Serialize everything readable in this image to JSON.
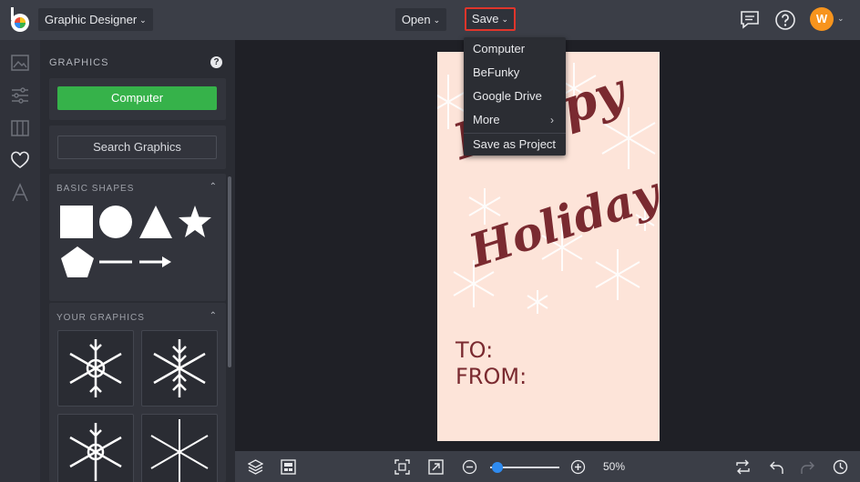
{
  "topbar": {
    "app_name": "Graphic Designer",
    "open_label": "Open",
    "save_label": "Save",
    "avatar_initial": "W"
  },
  "save_menu": {
    "items": [
      "Computer",
      "BeFunky",
      "Google Drive",
      "More",
      "Save as Project"
    ]
  },
  "panel": {
    "title": "GRAPHICS",
    "computer_button": "Computer",
    "search_button": "Search Graphics",
    "basic_shapes_label": "BASIC SHAPES",
    "your_graphics_label": "YOUR GRAPHICS"
  },
  "card": {
    "line1": "Happy",
    "line2": "Holidays",
    "to_label": "TO:",
    "from_label": "FROM:"
  },
  "bottombar": {
    "zoom_value": "50%"
  },
  "colors": {
    "accent_save_border": "#e0352b",
    "green_button": "#36b24a",
    "avatar": "#f7941d",
    "card_background": "#fde4d9",
    "card_text": "#7a2a30",
    "zoom_knob": "#2f8bf0"
  },
  "icons": [
    "befunky-logo",
    "comment-icon",
    "help-icon",
    "image-icon",
    "sliders-icon",
    "columns-icon",
    "heart-icon",
    "text-icon",
    "layers-icon",
    "layout-icon",
    "fit-icon",
    "fullscreen-icon",
    "zoom-out-icon",
    "zoom-in-icon",
    "replace-icon",
    "undo-icon",
    "redo-icon",
    "history-icon"
  ]
}
